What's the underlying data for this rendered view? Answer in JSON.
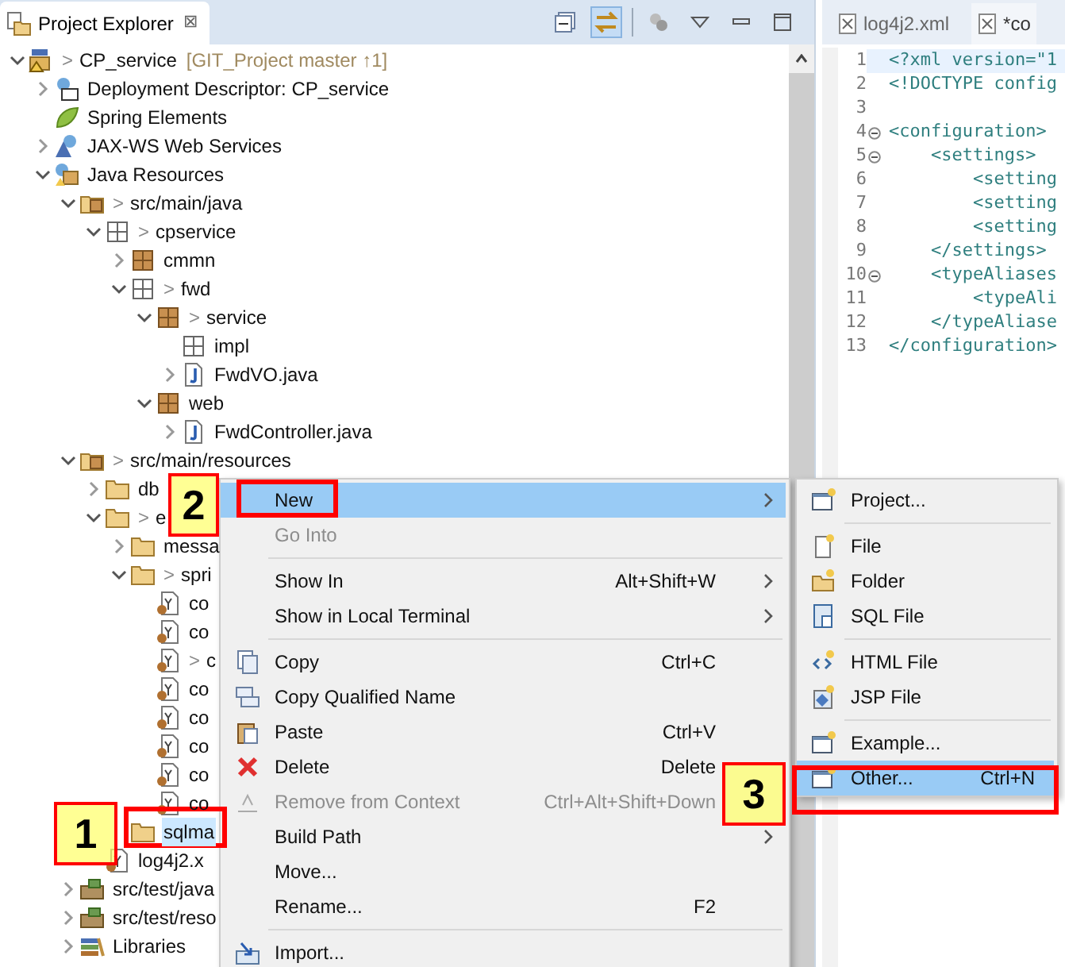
{
  "explorer": {
    "title": "Project Explorer",
    "close": "⊠",
    "tree": [
      {
        "label": "CP_service",
        "prefix": ">",
        "suffix": "[GIT_Project master ↑1]",
        "kind": "project",
        "expanded": true,
        "selected": false,
        "children": [
          {
            "label": "Deployment Descriptor: CP_service",
            "kind": "descriptor",
            "expanded": false,
            "selected": false
          },
          {
            "label": "Spring Elements",
            "kind": "spring",
            "selected": false
          },
          {
            "label": "JAX-WS Web Services",
            "kind": "webservices",
            "expanded": false,
            "selected": false
          },
          {
            "label": "Java Resources",
            "kind": "javares",
            "expanded": true,
            "selected": false,
            "children": [
              {
                "label": "src/main/java",
                "prefix": ">",
                "kind": "srcfolder",
                "expanded": true,
                "selected": false,
                "children": [
                  {
                    "label": "cpservice",
                    "prefix": ">",
                    "kind": "emptypackage",
                    "expanded": true,
                    "selected": false,
                    "children": [
                      {
                        "label": "cmmn",
                        "kind": "package",
                        "expanded": false,
                        "selected": false
                      },
                      {
                        "label": "fwd",
                        "prefix": ">",
                        "kind": "emptypackage",
                        "expanded": true,
                        "selected": false,
                        "children": [
                          {
                            "label": "service",
                            "prefix": ">",
                            "kind": "package",
                            "expanded": true,
                            "selected": false,
                            "children": [
                              {
                                "label": "impl",
                                "kind": "emptypackage",
                                "selected": false
                              },
                              {
                                "label": "FwdVO.java",
                                "kind": "java",
                                "expanded": false,
                                "selected": false
                              }
                            ]
                          },
                          {
                            "label": "web",
                            "kind": "package",
                            "expanded": true,
                            "selected": false,
                            "children": [
                              {
                                "label": "FwdController.java",
                                "kind": "java",
                                "expanded": false,
                                "selected": false
                              }
                            ]
                          }
                        ]
                      }
                    ]
                  }
                ]
              },
              {
                "label": "src/main/resources",
                "prefix": ">",
                "kind": "srcfolder",
                "expanded": true,
                "selected": false,
                "children": [
                  {
                    "label": "db",
                    "kind": "folder",
                    "expanded": false,
                    "selected": false
                  },
                  {
                    "label": "e",
                    "prefix": ">",
                    "kind": "folder",
                    "expanded": true,
                    "selected": false,
                    "children": [
                      {
                        "label": "messa",
                        "kind": "folder",
                        "expanded": false,
                        "selected": false
                      },
                      {
                        "label": "spri",
                        "prefix": ">",
                        "kind": "folder",
                        "expanded": true,
                        "selected": false,
                        "children": [
                          {
                            "label": "co",
                            "kind": "yaml",
                            "selected": false
                          },
                          {
                            "label": "co",
                            "kind": "yaml",
                            "selected": false
                          },
                          {
                            "label": "c",
                            "prefix": ">",
                            "kind": "yaml",
                            "selected": false
                          },
                          {
                            "label": "co",
                            "kind": "yaml",
                            "selected": false
                          },
                          {
                            "label": "co",
                            "kind": "yaml",
                            "selected": false
                          },
                          {
                            "label": "co",
                            "kind": "yaml",
                            "selected": false
                          },
                          {
                            "label": "co",
                            "kind": "yaml",
                            "selected": false
                          },
                          {
                            "label": "co",
                            "kind": "yaml",
                            "selected": false
                          }
                        ]
                      },
                      {
                        "label": "sqlma",
                        "kind": "folder",
                        "selected": true
                      }
                    ]
                  },
                  {
                    "label": "log4j2.x",
                    "kind": "yaml",
                    "selected": false
                  }
                ]
              },
              {
                "label": "src/test/java",
                "kind": "testfolder",
                "expanded": false,
                "selected": false
              },
              {
                "label": "src/test/reso",
                "kind": "testfolder",
                "expanded": false,
                "selected": false
              },
              {
                "label": "Libraries",
                "kind": "library",
                "expanded": false,
                "selected": false
              }
            ]
          }
        ]
      }
    ]
  },
  "editor": {
    "tabs": [
      {
        "label": "log4j2.xml",
        "selected": false
      },
      {
        "label": "*co",
        "selected": true
      }
    ],
    "lines": [
      {
        "number": "1",
        "code": "<?xml version=\"1"
      },
      {
        "number": "2",
        "code": "<!DOCTYPE config"
      },
      {
        "number": "3"
      },
      {
        "number": "4",
        "code": "<configuration>",
        "fold": true
      },
      {
        "number": "5",
        "code": "    <settings>",
        "fold": true
      },
      {
        "number": "6",
        "code": "        <setting"
      },
      {
        "number": "7",
        "code": "        <setting"
      },
      {
        "number": "8",
        "code": "        <setting"
      },
      {
        "number": "9",
        "code": "    </settings>"
      },
      {
        "number": "10",
        "code": "    <typeAliases",
        "fold": true
      },
      {
        "number": "11",
        "code": "        <typeAli"
      },
      {
        "number": "12",
        "code": "    </typeAliase"
      },
      {
        "number": "13",
        "code": "</configuration>"
      }
    ]
  },
  "context_menu": {
    "items": [
      {
        "kind": "plain",
        "label": "New",
        "submenu": true,
        "selected": true,
        "disabled": false
      },
      {
        "kind": "plain",
        "label": "Go Into",
        "selected": false,
        "disabled": true
      },
      {
        "kind": "separator"
      },
      {
        "kind": "plain",
        "label": "Show In",
        "shortcut": "Alt+Shift+W",
        "submenu": true,
        "selected": false,
        "disabled": false
      },
      {
        "kind": "plain",
        "label": "Show in Local Terminal",
        "submenu": true,
        "selected": false,
        "disabled": false
      },
      {
        "kind": "separator"
      },
      {
        "kind": "copy",
        "label": "Copy",
        "shortcut": "Ctrl+C",
        "selected": false,
        "disabled": false
      },
      {
        "kind": "copyname",
        "label": "Copy Qualified Name",
        "selected": false,
        "disabled": false
      },
      {
        "kind": "paste",
        "label": "Paste",
        "shortcut": "Ctrl+V",
        "selected": false,
        "disabled": false
      },
      {
        "kind": "delete",
        "label": "Delete",
        "shortcut": "Delete",
        "selected": false,
        "disabled": false
      },
      {
        "kind": "remove",
        "label": "Remove from Context",
        "shortcut": "Ctrl+Alt+Shift+Down",
        "selected": false,
        "disabled": true
      },
      {
        "kind": "plain",
        "label": "Build Path",
        "submenu": true,
        "selected": false,
        "disabled": false
      },
      {
        "kind": "plain",
        "label": "Move...",
        "selected": false,
        "disabled": false
      },
      {
        "kind": "plain",
        "label": "Rename...",
        "shortcut": "F2",
        "selected": false,
        "disabled": false
      },
      {
        "kind": "separator"
      },
      {
        "kind": "import",
        "label": "Import...",
        "selected": false,
        "disabled": false
      }
    ]
  },
  "submenu": {
    "items": [
      {
        "kind": "wizard",
        "label": "Project...",
        "selected": false
      },
      {
        "kind": "separator"
      },
      {
        "kind": "file",
        "label": "File",
        "selected": false
      },
      {
        "kind": "folder",
        "label": "Folder",
        "selected": false
      },
      {
        "kind": "sql",
        "label": "SQL File",
        "selected": false
      },
      {
        "kind": "separator"
      },
      {
        "kind": "html",
        "label": "HTML File",
        "selected": false
      },
      {
        "kind": "jsp",
        "label": "JSP File",
        "selected": false
      },
      {
        "kind": "separator"
      },
      {
        "kind": "wizard",
        "label": "Example...",
        "selected": false
      },
      {
        "kind": "wizard",
        "label": "Other...",
        "shortcut": "Ctrl+N",
        "selected": true
      }
    ]
  },
  "callouts": [
    {
      "label": "2"
    },
    {
      "label": "3"
    },
    {
      "label": "1"
    }
  ]
}
